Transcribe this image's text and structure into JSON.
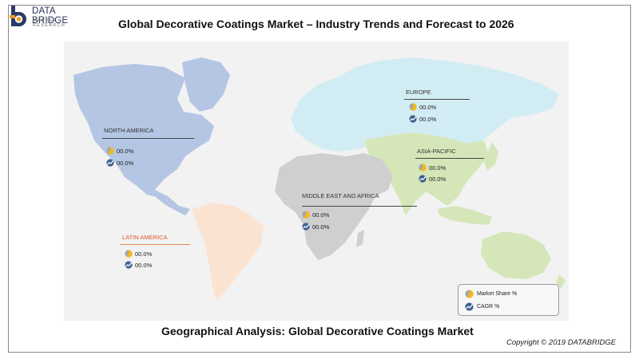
{
  "logo": {
    "brand": "DATA BRIDGE",
    "sub": "MARKET RESEARCH"
  },
  "title": "Global Decorative Coatings Market – Industry Trends and Forecast to 2026",
  "subtitle": "Geographical Analysis: Global Decorative Coatings Market",
  "copyright": "Copyright © 2019 DATABRIDGE",
  "regions": {
    "north_america": {
      "name": "NORTH AMERICA",
      "market_share": "00.0%",
      "cagr": "00.0%",
      "color": "#b4c6e3"
    },
    "europe": {
      "name": "EUROPE",
      "market_share": "00.0%",
      "cagr": "00.0%",
      "color": "#d2ecf3"
    },
    "asia_pacific": {
      "name": "ASIA-PACIFIC",
      "market_share": "00.0%",
      "cagr": "00.0%",
      "color": "#d5e6b8"
    },
    "middle_east_africa": {
      "name": "MIDDLE EAST AND AFRICA",
      "market_share": "00.0%",
      "cagr": "00.0%",
      "color": "#cfcfcf"
    },
    "latin_america": {
      "name": "LATIN AMERICA",
      "market_share": "00.0%",
      "cagr": "00.0%",
      "color": "#fbe3d2"
    }
  },
  "legend": {
    "market_share": "Market Share %",
    "cagr": "CAGR %"
  },
  "colors": {
    "pie_gold": "#f3b820",
    "pie_grey": "#a6a6a6",
    "cagr_blue": "#3f5f8f",
    "frame_border": "#8a8a8a"
  },
  "icons": [
    "market-share-pie-icon",
    "cagr-trend-icon",
    "data-bridge-logo-icon"
  ]
}
